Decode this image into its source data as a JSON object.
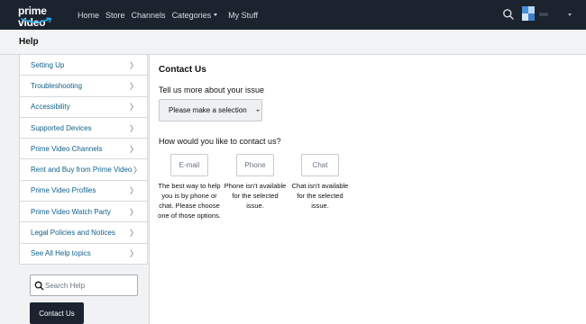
{
  "navbar": {
    "logo_text": "prime video",
    "links": [
      {
        "label": "Home"
      },
      {
        "label": "Store"
      },
      {
        "label": "Channels"
      },
      {
        "label": "Categories"
      },
      {
        "label": "My Stuff"
      }
    ],
    "search_icon": "search-icon",
    "avatar_icon": "avatar-icon",
    "profile_caret_icon": "chevron-down-icon"
  },
  "helpbar": {
    "title": "Help"
  },
  "sidebar": {
    "items": [
      {
        "label": "Setting Up"
      },
      {
        "label": "Troubleshooting"
      },
      {
        "label": "Accessibility"
      },
      {
        "label": "Supported Devices"
      },
      {
        "label": "Prime Video Channels"
      },
      {
        "label": "Rent and Buy from Prime Video"
      },
      {
        "label": "Prime Video Profiles"
      },
      {
        "label": "Prime Video Watch Party"
      },
      {
        "label": "Legal Policies and Notices"
      },
      {
        "label": "See All Help topics"
      }
    ],
    "chevron": "〉",
    "search_placeholder": "Search Help",
    "contact_button": "Contact Us"
  },
  "main": {
    "title": "Contact Us",
    "issue_label": "Tell us more about your issue",
    "select_value": "Please make a selection",
    "how_label": "How would you like to contact us?",
    "options": [
      {
        "label": "E-mail",
        "description": "The best way to help you is by phone or chat. Please choose one of those options."
      },
      {
        "label": "Phone",
        "description": "Phone isn't available for the selected issue."
      },
      {
        "label": "Chat",
        "description": "Chat isn't available for the selected issue."
      }
    ]
  },
  "colors": {
    "navbar_bg": "#1a232e",
    "link_color": "#0f5f8a",
    "helpbar_bg": "#f2f3f4"
  }
}
